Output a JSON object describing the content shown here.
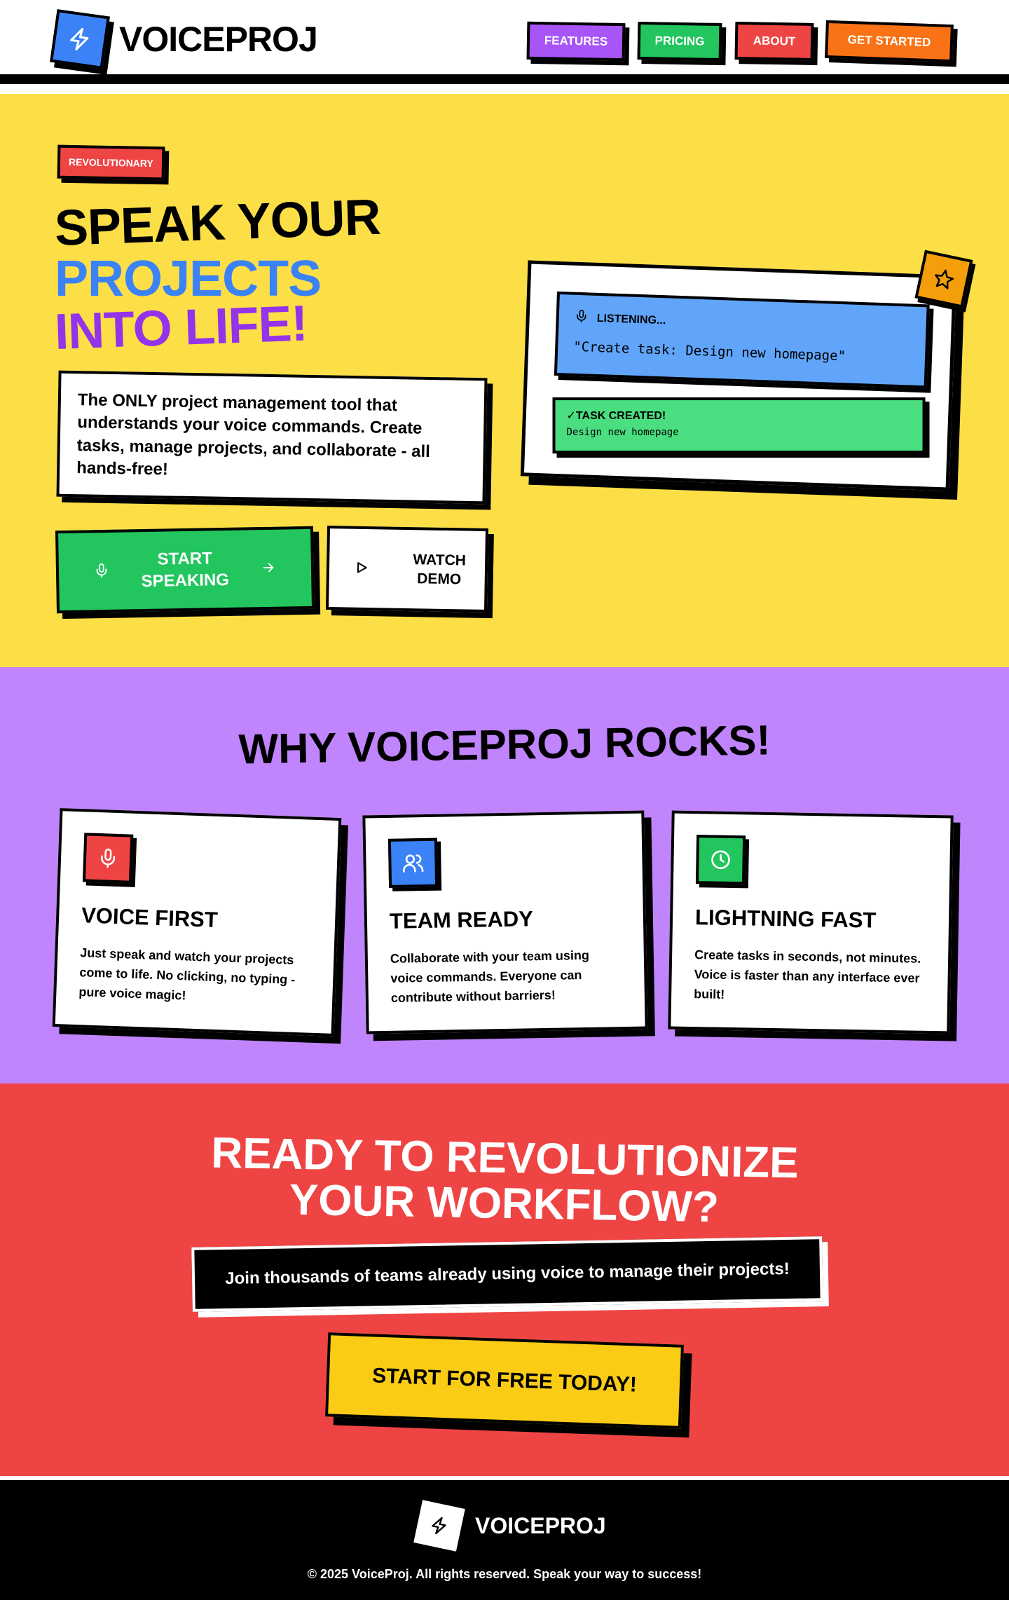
{
  "brand": {
    "name": "VOICEPROJ",
    "accent": "#3b82f6"
  },
  "nav": {
    "features": "FEATURES",
    "pricing": "PRICING",
    "about": "ABOUT",
    "get_started": "GET STARTED"
  },
  "hero": {
    "badge": "REVOLUTIONARY",
    "title_line1": "SPEAK YOUR",
    "title_line2": "PROJECTS",
    "title_line3": "INTO LIFE!",
    "description": "The ONLY project management tool that understands your voice commands. Create tasks, manage projects, and collaborate - all hands-free!",
    "start_button": "START SPEAKING",
    "demo_button": "WATCH DEMO",
    "bg_color": "#fcdf47"
  },
  "demo": {
    "listening_label": "LISTENING...",
    "command": "\"Create task: Design new homepage\"",
    "created_label": "✓TASK CREATED!",
    "created_task": "Design new homepage"
  },
  "features": {
    "title": "WHY VOICEPROJ ROCKS!",
    "cards": [
      {
        "icon": "mic-icon",
        "color": "#ef4444",
        "title": "VOICE FIRST",
        "text": "Just speak and watch your projects come to life. No clicking, no typing - pure voice magic!"
      },
      {
        "icon": "users-icon",
        "color": "#3b82f6",
        "title": "TEAM READY",
        "text": "Collaborate with your team using voice commands. Everyone can contribute without barriers!"
      },
      {
        "icon": "clock-icon",
        "color": "#22c55e",
        "title": "LIGHTNING FAST",
        "text": "Create tasks in seconds, not minutes. Voice is faster than any interface ever built!"
      }
    ]
  },
  "cta": {
    "title_line1": "READY TO REVOLUTIONIZE",
    "title_line2": "YOUR WORKFLOW?",
    "subtitle": "Join thousands of teams already using voice to manage their projects!",
    "button": "START FOR FREE TODAY!"
  },
  "footer": {
    "name": "VOICEPROJ",
    "copyright": "© 2025 VoiceProj. All rights reserved. Speak your way to success!"
  }
}
